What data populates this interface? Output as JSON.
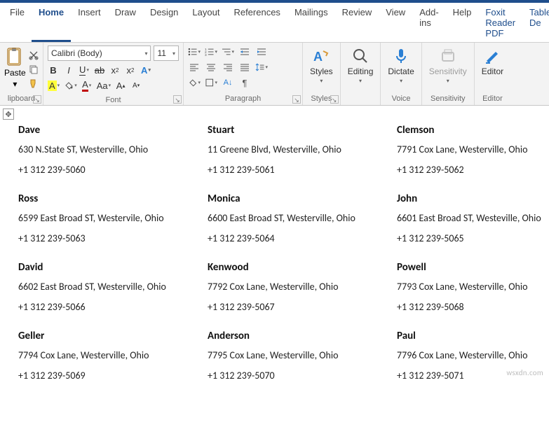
{
  "tabs": {
    "file": "File",
    "home": "Home",
    "insert": "Insert",
    "draw": "Draw",
    "design": "Design",
    "layout": "Layout",
    "references": "References",
    "mailings": "Mailings",
    "review": "Review",
    "view": "View",
    "addins": "Add-ins",
    "help": "Help",
    "foxit": "Foxit Reader PDF",
    "tablede": "Table De"
  },
  "ribbon": {
    "clipboard": {
      "paste": "Paste",
      "label": "lipboard"
    },
    "font": {
      "name": "Calibri (Body)",
      "size": "11",
      "label": "Font"
    },
    "paragraph": {
      "label": "Paragraph"
    },
    "styles": {
      "btn": "Styles",
      "label": "Styles"
    },
    "editing": {
      "btn": "Editing"
    },
    "voice": {
      "btn": "Dictate",
      "label": "Voice"
    },
    "sensitivity": {
      "btn": "Sensitivity",
      "label": "Sensitivity"
    },
    "editor": {
      "btn": "Editor",
      "label": "Editor"
    }
  },
  "labels": [
    {
      "name": "Dave",
      "addr": "630 N.State ST, Westerville, Ohio",
      "phone": "+1 312 239-5060"
    },
    {
      "name": "Stuart",
      "addr": "11 Greene Blvd, Westerville, Ohio",
      "phone": "+1 312 239-5061"
    },
    {
      "name": "Clemson",
      "addr": "7791 Cox Lane, Westerville, Ohio",
      "phone": "+1 312 239-5062"
    },
    {
      "name": "Ross",
      "addr": "6599 East Broad ST, Westervile, Ohio",
      "phone": "+1 312 239-5063"
    },
    {
      "name": "Monica",
      "addr": "6600 East Broad ST, Westerville, Ohio",
      "phone": "+1 312 239-5064"
    },
    {
      "name": "John",
      "addr": "6601 East Broad ST, Westeville, Ohio",
      "phone": "+1 312 239-5065"
    },
    {
      "name": "David",
      "addr": "6602 East Broad ST, Westerville, Ohio",
      "phone": "+1 312 239-5066"
    },
    {
      "name": "Kenwood",
      "addr": "7792 Cox Lane, Westerville, Ohio",
      "phone": "+1 312 239-5067"
    },
    {
      "name": "Powell",
      "addr": "7793 Cox Lane, Westerville, Ohio",
      "phone": "+1 312 239-5068"
    },
    {
      "name": "Geller",
      "addr": "7794 Cox Lane, Westerville, Ohio",
      "phone": "+1 312 239-5069"
    },
    {
      "name": "Anderson",
      "addr": "7795 Cox Lane, Westerville, Ohio",
      "phone": "+1 312 239-5070"
    },
    {
      "name": "Paul",
      "addr": "7796 Cox Lane, Westerville, Ohio",
      "phone": "+1 312 239-5071"
    }
  ],
  "watermark": "wsxdn.com"
}
